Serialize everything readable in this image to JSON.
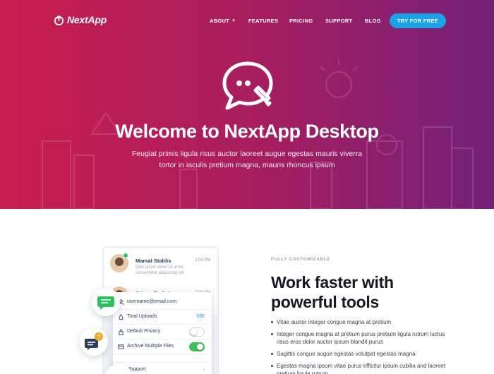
{
  "brand": {
    "name": "NextApp"
  },
  "nav": {
    "items": [
      {
        "label": "ABOUT",
        "has_dropdown": true
      },
      {
        "label": "FEATURES"
      },
      {
        "label": "PRICING"
      },
      {
        "label": "SUPPORT"
      },
      {
        "label": "BLOG"
      }
    ],
    "cta_label": "TRY FOR FREE"
  },
  "hero": {
    "title": "Welcome to NextApp Desktop",
    "subtitle_line1": "Feugiat primis ligula risus auctor laoreet augue egestas mauris viverra",
    "subtitle_line2": "tortor in iaculis pretium magna, mauris rhoncus ipsum",
    "icon": "chat-edit-icon"
  },
  "mockup": {
    "chats": [
      {
        "name": "Mamat Stablis",
        "time": "2:04 PM",
        "message": "Quis ipsum dolor sit amet, consectetur adipiscing elit"
      },
      {
        "name": "Jajang Serbet",
        "time": "2:00 PM",
        "message": ""
      }
    ],
    "settings": {
      "email": "username@email.com",
      "uploads_label": "Total Uploads",
      "uploads_value": "596",
      "privacy_label": "Default Privacy",
      "privacy_on": false,
      "archive_label": "Archive Multiple Files",
      "archive_on": true,
      "support_label": "Support"
    }
  },
  "section": {
    "eyebrow": "FULLY CUSTOMIZABLE",
    "title_line1": "Work faster with",
    "title_line2": "powerful tools",
    "features": [
      "Vitae auctor integer congue magna at pretium",
      "Integer congue magna at pretium purus pretium ligula rutrum luctus risus eros dolor auctor ipsum blandit purus",
      "Sagittis congue augue egestas volutpat egestas magna",
      "Egestas magna ipsum vitae purus efficitur ipsum cubilia and laoreet pretium ligula rutrum"
    ]
  },
  "colors": {
    "hero_gradient_start": "#c91d4f",
    "hero_gradient_end": "#73207a",
    "cta": "#1aa1e6",
    "toggle_on": "#3cc157",
    "bubble_green": "#2cc15d",
    "bubble_orange": "#f5a623"
  }
}
